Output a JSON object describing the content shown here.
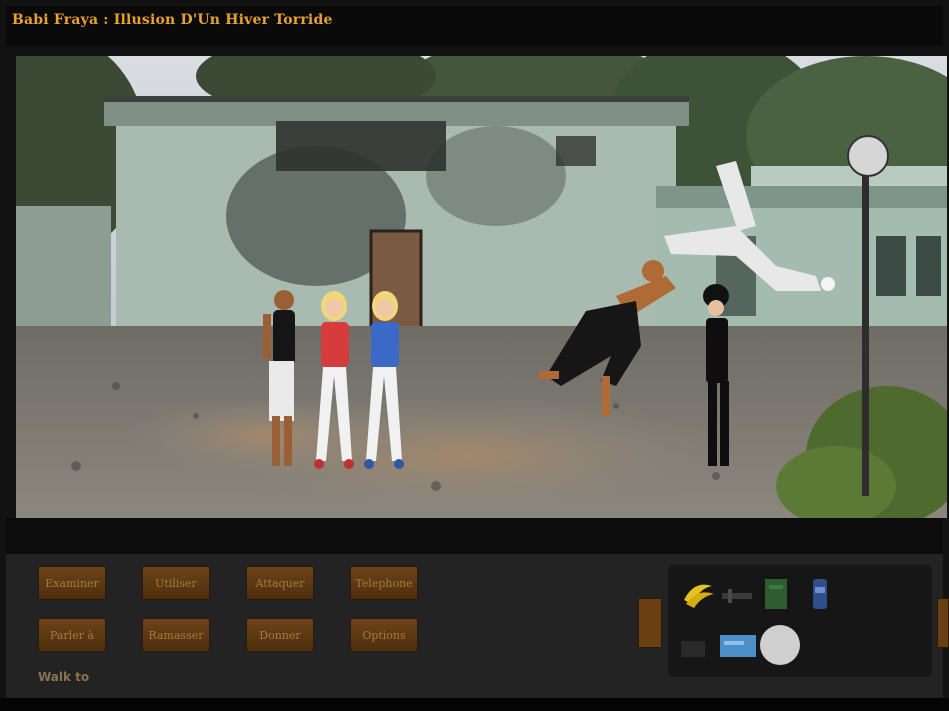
{
  "window": {
    "title": "Babi Fraya : Illusion D'Un Hiver Torride"
  },
  "verbs": {
    "row1": [
      "Examiner",
      "Utiliser",
      "Attaquer",
      "Telephone"
    ],
    "row2": [
      "Parler à",
      "Ramasser",
      "Donner",
      "Options"
    ]
  },
  "status": {
    "action_line": "Walk to"
  },
  "inventory": {
    "items": [
      "bananas-icon",
      "lockpick-icon",
      "green-package-icon",
      "can-icon",
      "dark-item-icon",
      "blue-card-icon",
      "round-stone-icon"
    ]
  },
  "colors": {
    "title": "#e8a12c",
    "button": "#6a3f14",
    "button_text": "#a77a3c",
    "hud": "#232323"
  }
}
